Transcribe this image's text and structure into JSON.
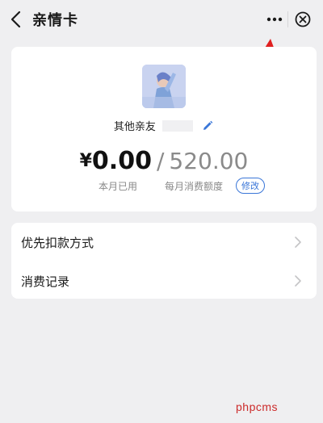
{
  "header": {
    "title": "亲情卡",
    "back_icon": "chevron-left-icon",
    "more_icon": "more-dots-icon",
    "close_icon": "close-circle-icon"
  },
  "card": {
    "name_label": "其他亲友",
    "currency_symbol": "¥",
    "used_amount": "0.00",
    "separator": "/",
    "monthly_limit": "520.00",
    "used_label": "本月已用",
    "limit_label": "每月消费额度",
    "modify_label": "修改"
  },
  "menu": {
    "items": [
      {
        "label": "优先扣款方式"
      },
      {
        "label": "消费记录"
      }
    ]
  },
  "watermark": "phpcms",
  "colors": {
    "background": "#efeff1",
    "card": "#ffffff",
    "accent_blue": "#3a76d8",
    "annotation_red": "#e02020"
  }
}
